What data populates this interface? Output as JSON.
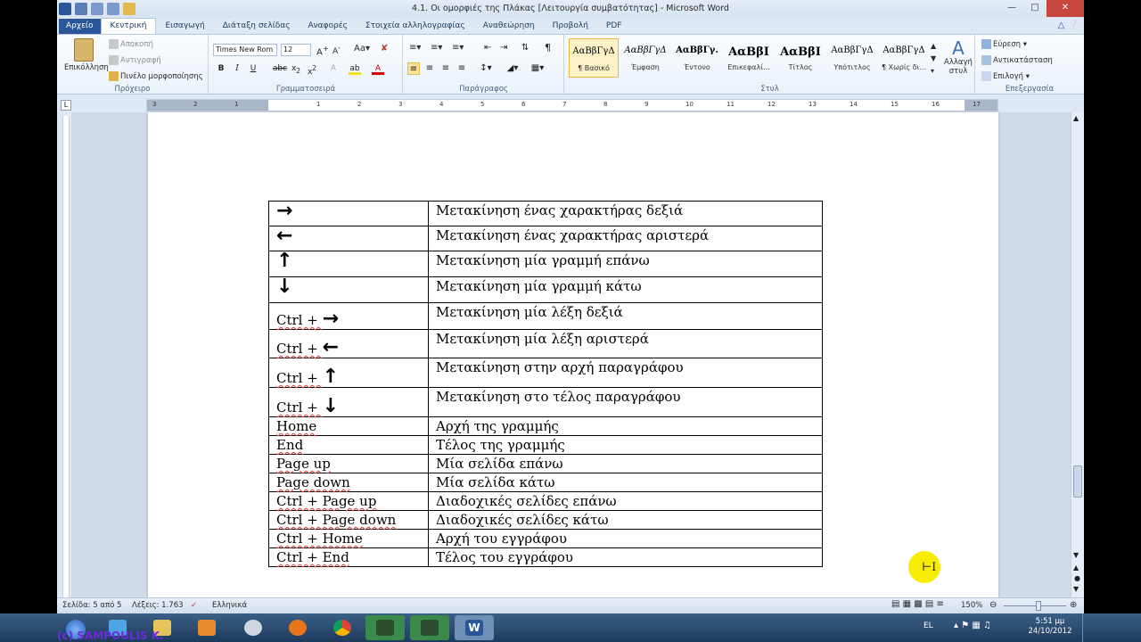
{
  "window": {
    "title": "4.1. Οι ομορφιές της Πλάκας [Λειτουργία συμβατότητας] - Microsoft Word"
  },
  "tabs": [
    "Αρχείο",
    "Κεντρική",
    "Εισαγωγή",
    "Διάταξη σελίδας",
    "Αναφορές",
    "Στοιχεία αλληλογραφίας",
    "Αναθεώρηση",
    "Προβολή",
    "PDF"
  ],
  "ribbon": {
    "clipboard": {
      "paste": "Επικόλληση",
      "cut": "Αποκοπή",
      "copy": "Αντιγραφή",
      "format_painter": "Πινέλο μορφοποίησης",
      "label": "Πρόχειρο"
    },
    "font": {
      "name": "Times New Rom",
      "size": "12",
      "label": "Γραμματοσειρά"
    },
    "paragraph": {
      "label": "Παράγραφος"
    },
    "styles": {
      "label": "Στυλ",
      "items": [
        {
          "preview": "ΑαΒβΓγΔ",
          "name": "¶ Βασικό"
        },
        {
          "preview": "ΑαΒβΓγΔ",
          "name": "Έμφαση"
        },
        {
          "preview": "ΑαΒβΓγ.",
          "name": "Έντονο"
        },
        {
          "preview": "ΑαΒβΙ",
          "name": "Επικεφαλί..."
        },
        {
          "preview": "ΑαΒβΙ",
          "name": "Τίτλος"
        },
        {
          "preview": "ΑαΒβΓγΔ",
          "name": "Υπότιτλος"
        },
        {
          "preview": "ΑαΒβΓγΔ",
          "name": "¶ Χωρίς δι..."
        }
      ],
      "change": "Αλλαγή στυλ"
    },
    "editing": {
      "find": "Εύρεση",
      "replace": "Αντικατάσταση",
      "select": "Επιλογή",
      "label": "Επεξεργασία"
    }
  },
  "ruler": [
    "3",
    "2",
    "1",
    "1",
    "2",
    "3",
    "4",
    "5",
    "6",
    "7",
    "8",
    "9",
    "10",
    "11",
    "12",
    "13",
    "14",
    "15",
    "16",
    "17"
  ],
  "table": [
    {
      "key": "",
      "arrow": "→",
      "desc": "Μετακίνηση ένας χαρακτήρας δεξιά"
    },
    {
      "key": "",
      "arrow": "←",
      "desc": "Μετακίνηση ένας χαρακτήρας αριστερά"
    },
    {
      "key": "",
      "arrow": "↑",
      "desc": "Μετακίνηση μία γραμμή επάνω"
    },
    {
      "key": "",
      "arrow": "↓",
      "desc": "Μετακίνηση μία γραμμή κάτω"
    },
    {
      "key": "Ctrl + ",
      "arrow": "→",
      "desc": "Μετακίνηση μία λέξη δεξιά"
    },
    {
      "key": "Ctrl + ",
      "arrow": "←",
      "desc": "Μετακίνηση μία λέξη αριστερά"
    },
    {
      "key": "Ctrl + ",
      "arrow": "↑",
      "desc": "Μετακίνηση στην αρχή παραγράφου"
    },
    {
      "key": "Ctrl + ",
      "arrow": "↓",
      "desc": "Μετακίνηση στο τέλος παραγράφου"
    },
    {
      "key": "Home",
      "arrow": "",
      "desc": "Αρχή της γραμμής"
    },
    {
      "key": "End",
      "arrow": "",
      "desc": "Τέλος της γραμμής"
    },
    {
      "key": "Page up",
      "arrow": "",
      "desc": "Μία σελίδα επάνω"
    },
    {
      "key": "Page down",
      "arrow": "",
      "desc": "Μία σελίδα κάτω"
    },
    {
      "key": "Ctrl + Page up",
      "arrow": "",
      "desc": "Διαδοχικές σελίδες επάνω"
    },
    {
      "key": "Ctrl + Page down",
      "arrow": "",
      "desc": "Διαδοχικές σελίδες κάτω"
    },
    {
      "key": "Ctrl + Home",
      "arrow": "",
      "desc": "Αρχή του εγγράφου"
    },
    {
      "key": "Ctrl + End",
      "arrow": "",
      "desc": "Τέλος του εγγράφου"
    }
  ],
  "status": {
    "page": "Σελίδα: 5 από 5",
    "words": "Λέξεις: 1.763",
    "language": "Ελληνικά",
    "zoom": "150%"
  },
  "taskbar": {
    "lang": "EL",
    "time": "5:51 μμ",
    "date": "24/10/2012",
    "watermark": "(c) SAMPOULIS K."
  },
  "colors": {
    "file_tab": "#2b579a",
    "taskbar": "#1d3a5c",
    "highlight": "#f8ec00"
  }
}
